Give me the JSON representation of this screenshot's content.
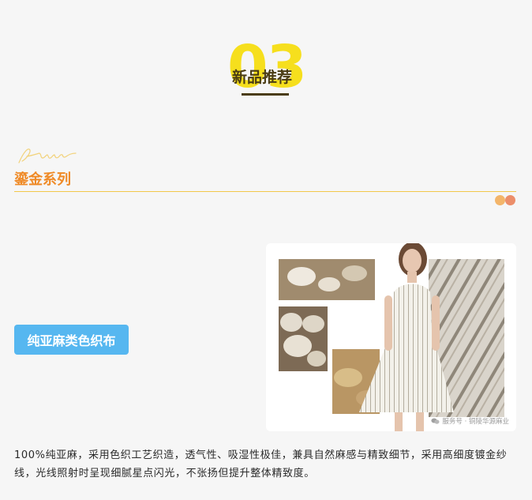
{
  "section": {
    "number": "03",
    "title": "新品推荐"
  },
  "series": {
    "logo_text": "Ashun",
    "title": "鎏金系列"
  },
  "product": {
    "tag_label": "纯亚麻类色织布",
    "watermark": "服务号 · 铜陵华源麻业",
    "description": "100%纯亚麻，采用色织工艺织造，透气性、吸湿性极佳，兼具自然麻感与精致细节，采用高细度镀金纱线，光线照射时呈现细腻星点闪光，不张扬但提升整体精致度。"
  },
  "colors": {
    "page_bg": "#f6f6f6",
    "number_yellow": "#f6df1d",
    "title_dark": "#4a3c14",
    "series_orange": "#ef8a26",
    "button_blue": "#56b7f0"
  }
}
